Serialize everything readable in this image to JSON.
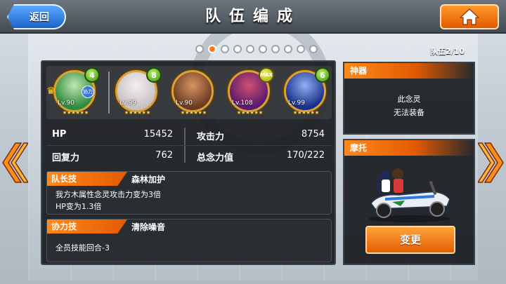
{
  "header": {
    "back_label": "返回",
    "title": "队伍编成"
  },
  "pager": {
    "total": 10,
    "current": 2,
    "team_label": "队伍2/10"
  },
  "members": [
    {
      "level_badge": "4",
      "lv": "Lv.90",
      "stars": "★★★★★★",
      "leader": true,
      "assist": "协力",
      "colors": [
        "#2f8a3d",
        "#bfe7b1"
      ]
    },
    {
      "level_badge": "8",
      "lv": "Lv.99",
      "stars": "★★★★★★",
      "leader": false,
      "assist": "",
      "colors": [
        "#c9c2c5",
        "#f4eef0"
      ]
    },
    {
      "level_badge": "",
      "lv": "Lv.90",
      "stars": "★★★★★★",
      "leader": false,
      "assist": "",
      "colors": [
        "#6a3b22",
        "#d89462"
      ]
    },
    {
      "level_badge": "MAX",
      "lv": "Lv.108",
      "stars": "★★★★★★",
      "leader": false,
      "assist": "",
      "colors": [
        "#5b1a6e",
        "#d05070"
      ]
    },
    {
      "level_badge": "6",
      "lv": "Lv.99",
      "stars": "★★★★★★",
      "leader": false,
      "assist": "",
      "colors": [
        "#1a2f8a",
        "#8fb0f2"
      ]
    }
  ],
  "stats": {
    "hp_label": "HP",
    "hp_value": "15452",
    "atk_label": "攻击力",
    "atk_value": "8754",
    "rec_label": "回复力",
    "rec_value": "762",
    "cost_label": "总念力值",
    "cost_value": "170/222"
  },
  "leader_skill": {
    "heading": "队长技",
    "name": "森林加护",
    "desc_line1": "我方木属性念灵攻击力变为3倍",
    "desc_line2": "HP变为1.3倍"
  },
  "assist_skill": {
    "heading": "协力技",
    "name": "清除噪音",
    "desc_line1": "全员技能回合-3"
  },
  "weapon": {
    "heading": "神器",
    "line1": "此念灵",
    "line2": "无法装备"
  },
  "bike": {
    "heading": "摩托",
    "change_label": "变更"
  },
  "colors": {
    "accent_orange": "#e25a00",
    "back_blue": "#1c63c9",
    "arrow_orange": "#ff8a1e"
  }
}
